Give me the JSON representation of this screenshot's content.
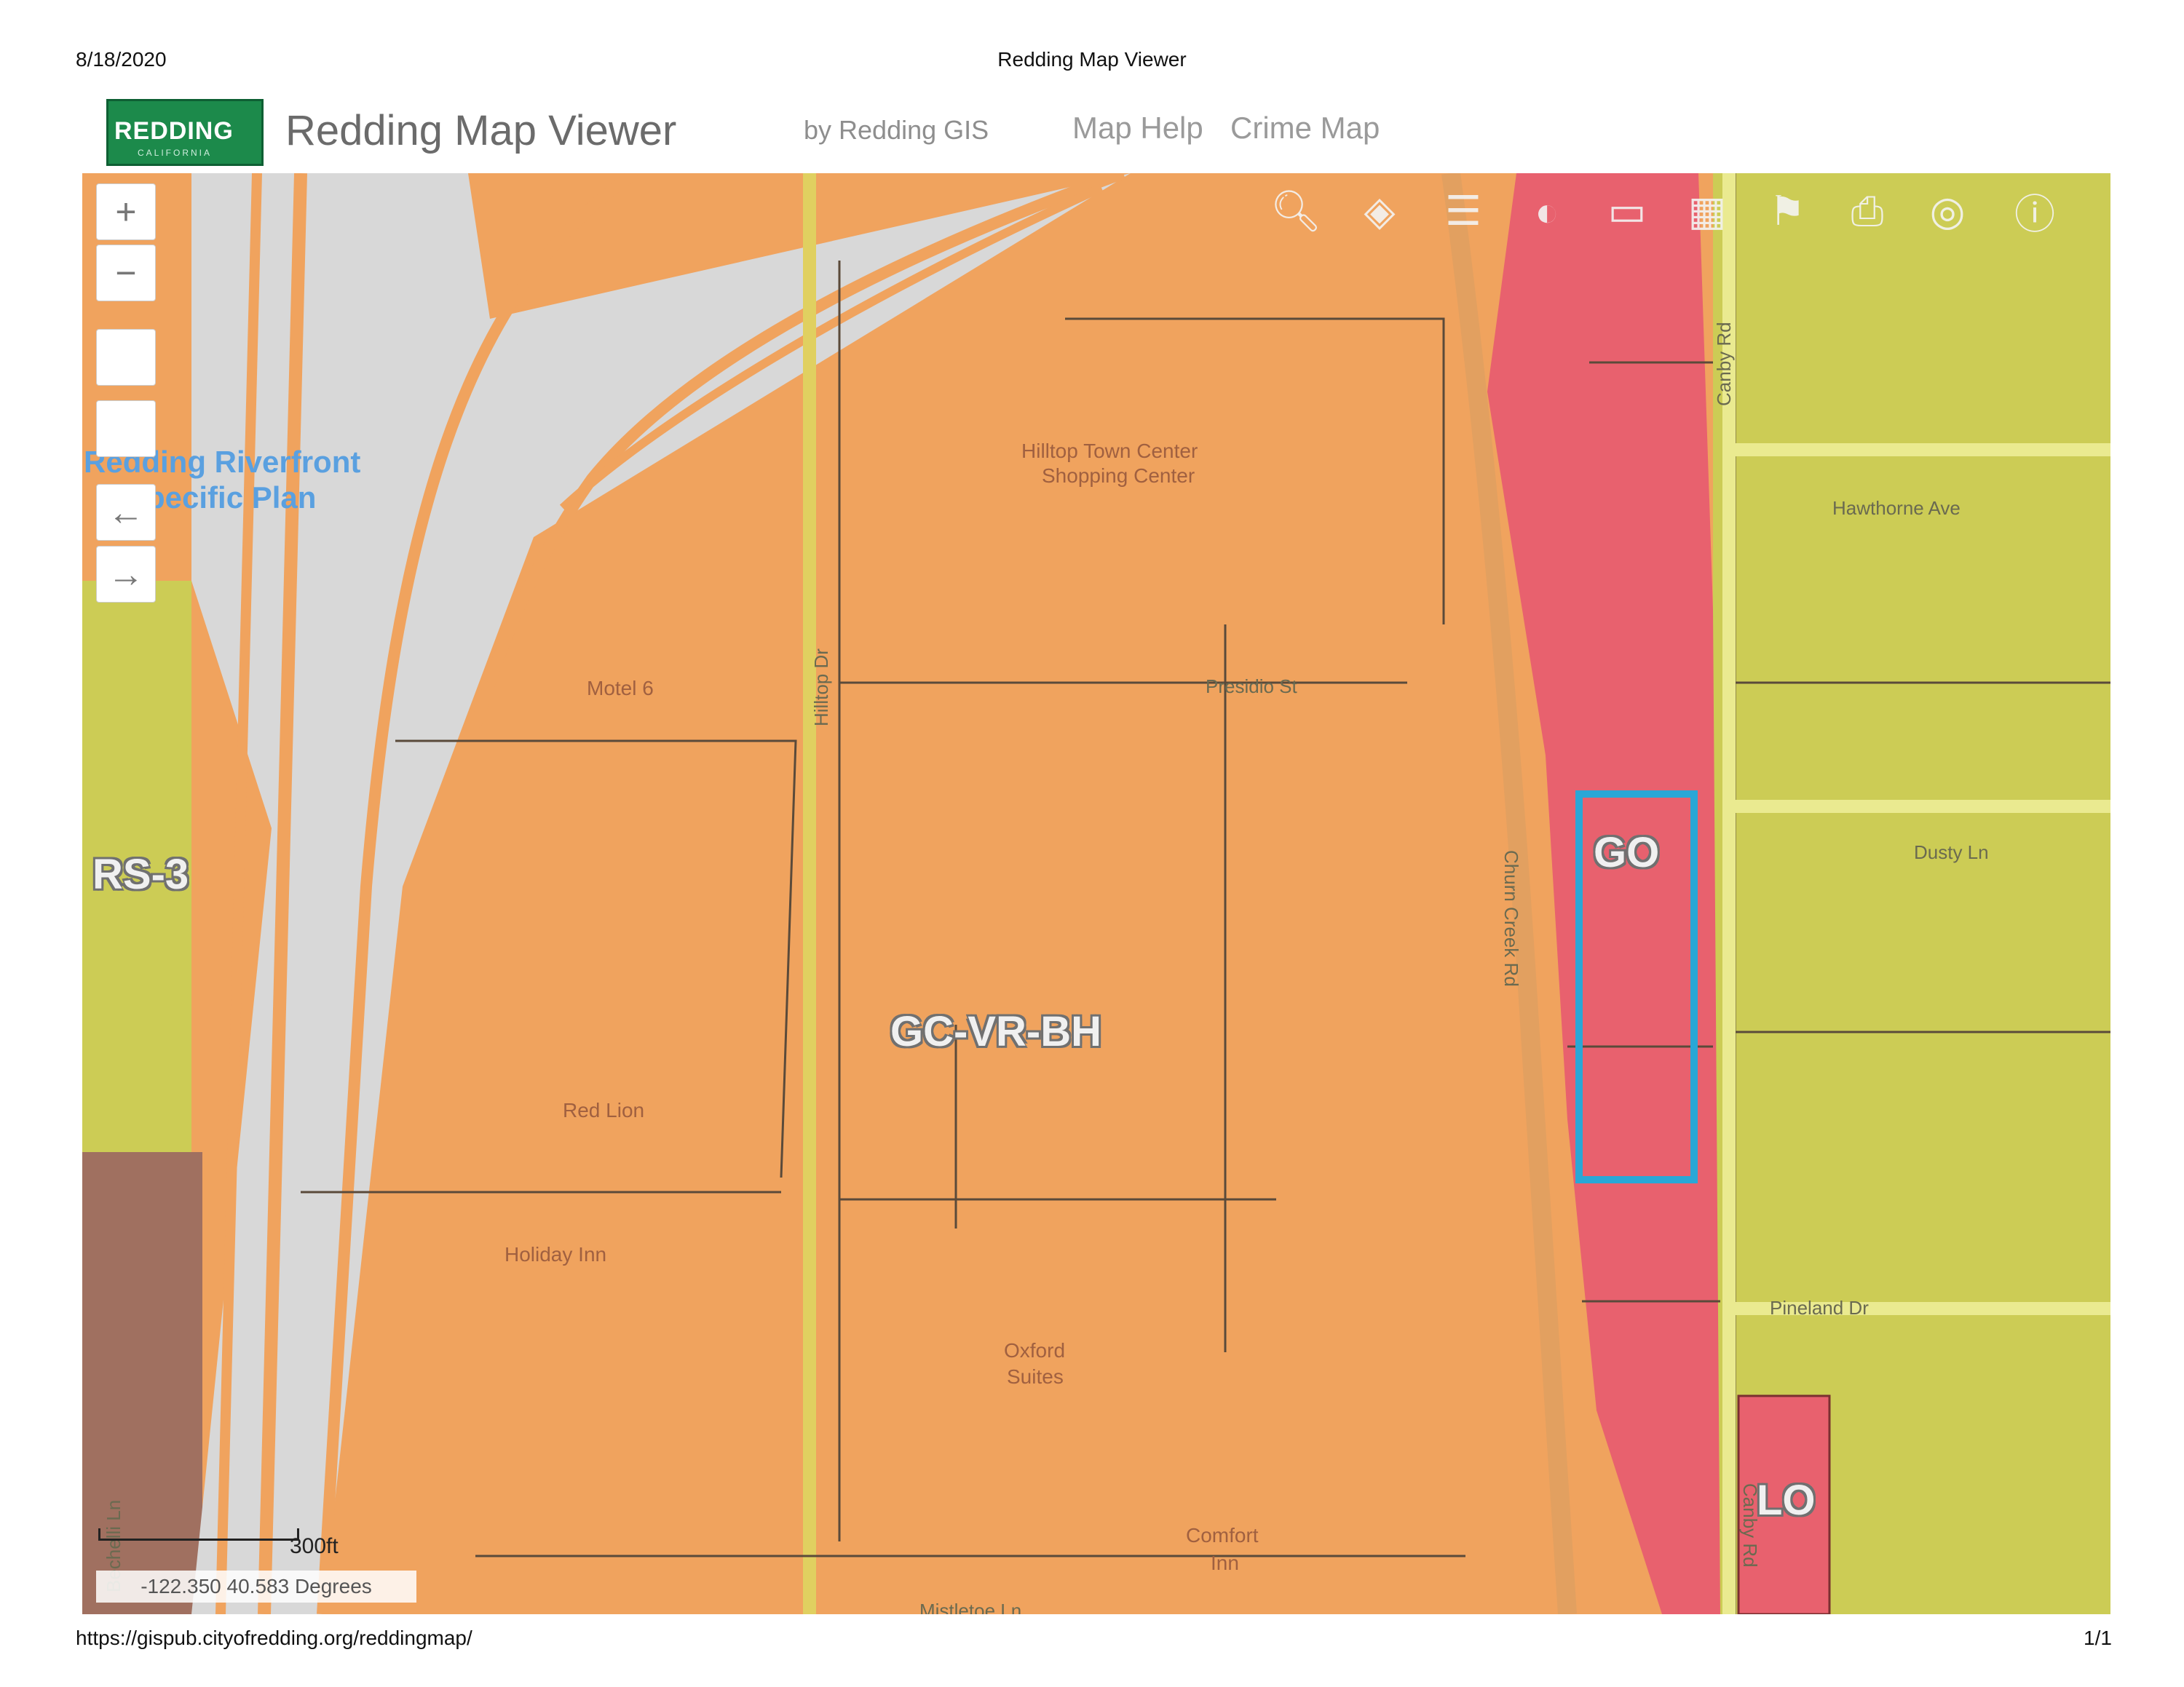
{
  "print": {
    "date": "8/18/2020",
    "title": "Redding Map Viewer",
    "url": "https://gispub.cityofredding.org/reddingmap/",
    "page": "1/1"
  },
  "header": {
    "logo_text": "REDDING",
    "logo_sub": "CALIFORNIA",
    "app_title": "Redding Map Viewer",
    "byline": "by Redding GIS",
    "links": [
      "Map Help",
      "Crime Map"
    ]
  },
  "toolbar": {
    "icons": [
      "search-icon",
      "layers-icon",
      "legend-icon",
      "basemap-icon",
      "measure-icon",
      "grid-icon",
      "bookmark-icon",
      "print-icon",
      "location-icon",
      "info-icon"
    ]
  },
  "map_controls": {
    "zoom_in": "+",
    "zoom_out": "−",
    "back": "←",
    "forward": "→"
  },
  "map": {
    "plan_label_line1": "Redding Riverfront",
    "plan_label_line2": "Specific Plan",
    "zones": {
      "rs3": "RS-3",
      "gc": "GC-VR-BH",
      "go": "GO",
      "lo": "LO"
    },
    "places": {
      "hilltop_line1": "Hilltop Town Center",
      "hilltop_line2": "Shopping Center",
      "motel6": "Motel 6",
      "red_lion": "Red Lion",
      "holiday_inn": "Holiday Inn",
      "oxford_line1": "Oxford",
      "oxford_line2": "Suites",
      "comfort_line1": "Comfort",
      "comfort_line2": "Inn"
    },
    "streets": {
      "hilltop_dr": "Hilltop Dr",
      "presidio": "Presidio St",
      "churn_creek": "Churn Creek Rd",
      "canby_top": "Canby Rd",
      "canby_bottom": "Canby Rd",
      "hawthorne": "Hawthorne Ave",
      "dusty": "Dusty Ln",
      "pineland": "Pineland Dr",
      "mistletoe": "Mistletoe Ln",
      "bechelli": "Bechelli Ln"
    },
    "scale_label": "300ft",
    "coordinates": "-122.350 40.583 Degrees"
  },
  "colors": {
    "commercial": "#f0a35e",
    "general_office": "#e8616e",
    "residential": "#cccc55",
    "selection_outline": "#2aa7d6",
    "logo_green": "#1c8a4b"
  }
}
